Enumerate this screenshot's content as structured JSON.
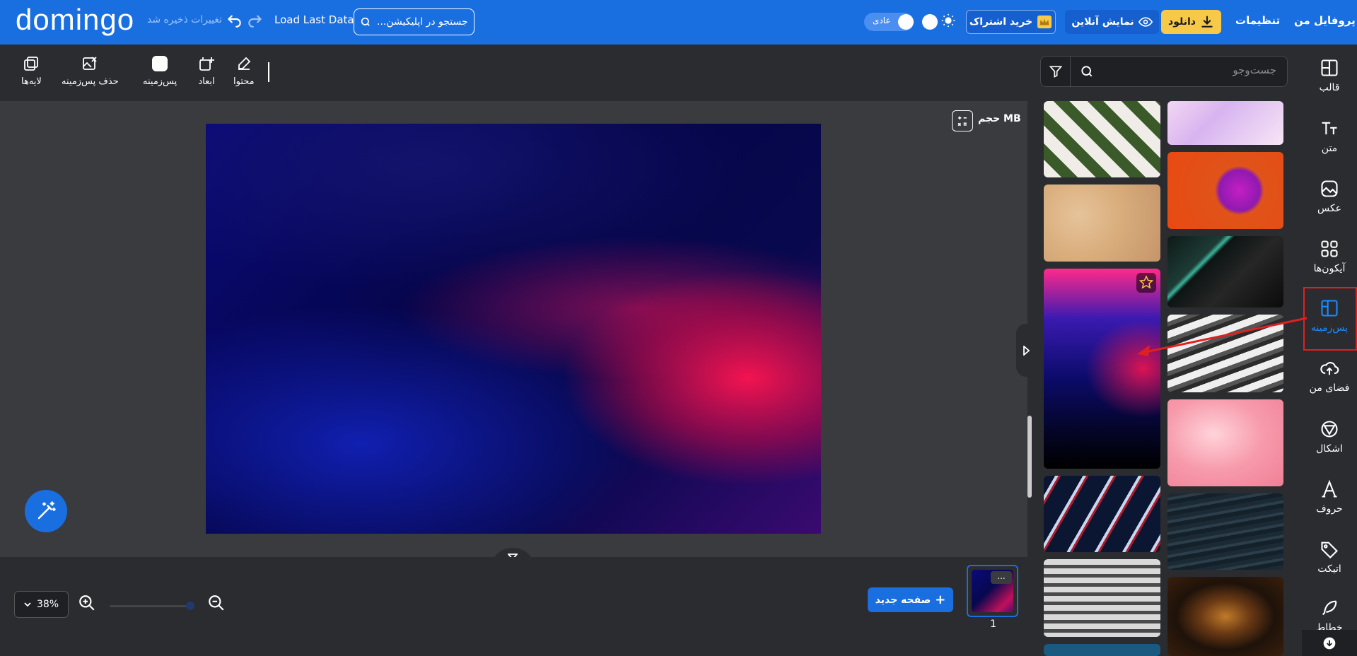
{
  "header": {
    "logo": "domingo",
    "saved_status": "تغییرات ذخیره شد",
    "load_last": "Load Last Data",
    "search_value": "...جستجو در اپلیکیشن",
    "mode_label": "عادی",
    "subscribe_label": "خرید اشتراک",
    "online_label": "نمایش آنلاین",
    "download_label": "دانلود",
    "settings_label": "تنظیمات",
    "profile_label": "پروفایل من"
  },
  "toolbar": {
    "layers_label": "لایه‌ها",
    "remove_bg_label": "حذف پس‌زمینه",
    "background_label": "پس‌زمینه",
    "dimensions_label": "ابعاد",
    "content_label": "محتوا"
  },
  "canvas": {
    "size_label": "حجم MB"
  },
  "bottom": {
    "zoom_value": "38%",
    "new_page_label": "صفحه جدید",
    "page_number": "1",
    "page_menu": "..."
  },
  "panel": {
    "search_placeholder": "جست‌وجو"
  },
  "nav": {
    "items": [
      {
        "label": "قالب",
        "icon": "layout-icon"
      },
      {
        "label": "متن",
        "icon": "text-icon"
      },
      {
        "label": "عکس",
        "icon": "image-icon"
      },
      {
        "label": "آیکون‌ها",
        "icon": "grid-icon"
      },
      {
        "label": "پس‌زمینه",
        "icon": "background-icon"
      },
      {
        "label": "فضای من",
        "icon": "cloud-upload-icon"
      },
      {
        "label": "اشکال",
        "icon": "shapes-icon"
      },
      {
        "label": "حروف",
        "icon": "letter-icon"
      },
      {
        "label": "اتیکت",
        "icon": "tag-icon"
      },
      {
        "label": "خطاط",
        "icon": "feather-icon"
      }
    ]
  },
  "colors": {
    "brand": "#1a6fe0",
    "download_accent": "#f7c948",
    "dark_panel": "#2b2c30",
    "annotation": "#e02020"
  }
}
